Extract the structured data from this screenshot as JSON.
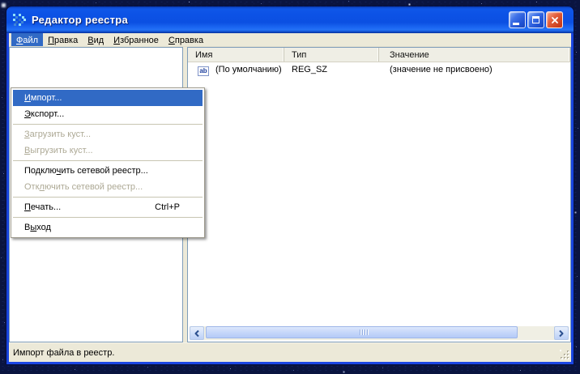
{
  "desktop": {
    "background_color": "#0A1440",
    "star_icon": "star-dots"
  },
  "window": {
    "title": "Редактор реестра",
    "app_icon": "registry-cube-icon",
    "controls": {
      "minimize_icon": "minimize-icon",
      "maximize_icon": "maximize-icon",
      "close_icon": "close-icon"
    }
  },
  "colors": {
    "selection_blue": "#316AC5",
    "titlebar_blue": "#0C52E6",
    "window_border_blue": "#1845DE",
    "face": "#ECE9D8",
    "disabled_text": "#ADA995"
  },
  "menubar": {
    "items": [
      {
        "pre": "",
        "key": "Ф",
        "post": "айл",
        "selected": true
      },
      {
        "pre": "",
        "key": "П",
        "post": "равка",
        "selected": false
      },
      {
        "pre": "",
        "key": "В",
        "post": "ид",
        "selected": false
      },
      {
        "pre": "",
        "key": "И",
        "post": "збранное",
        "selected": false
      },
      {
        "pre": "",
        "key": "С",
        "post": "правка",
        "selected": false
      }
    ]
  },
  "menu_dropdown": {
    "items": [
      {
        "pre": "",
        "key": "И",
        "post": "мпорт...",
        "state": "selected"
      },
      {
        "pre": "",
        "key": "Э",
        "post": "кспорт...",
        "state": "normal"
      },
      {
        "pre": "",
        "key": "З",
        "post": "агрузить куст...",
        "state": "disabled"
      },
      {
        "pre": "",
        "key": "В",
        "post": "ыгрузить куст...",
        "state": "disabled"
      },
      {
        "pre": "Подклю",
        "key": "ч",
        "post": "ить сетевой реестр...",
        "state": "normal"
      },
      {
        "pre": "Отк",
        "key": "л",
        "post": "ючить сетевой реестр...",
        "state": "disabled"
      },
      {
        "pre": "",
        "key": "П",
        "post": "ечать...",
        "shortcut": "Ctrl+P",
        "state": "normal"
      },
      {
        "pre": "В",
        "key": "ы",
        "post": "ход",
        "state": "normal"
      }
    ]
  },
  "list": {
    "columns": [
      {
        "label": "Имя"
      },
      {
        "label": "Тип"
      },
      {
        "label": "Значение"
      }
    ],
    "rows": [
      {
        "icon": "string-value-ab-icon",
        "icon_text": "ab",
        "name": "(По умолчанию)",
        "type": "REG_SZ",
        "value": "(значение не присвоено)"
      }
    ],
    "hscrollbar": {
      "left_icon": "chevron-left-icon",
      "right_icon": "chevron-right-icon"
    }
  },
  "statusbar": {
    "text": "Импорт файла в реестр."
  }
}
